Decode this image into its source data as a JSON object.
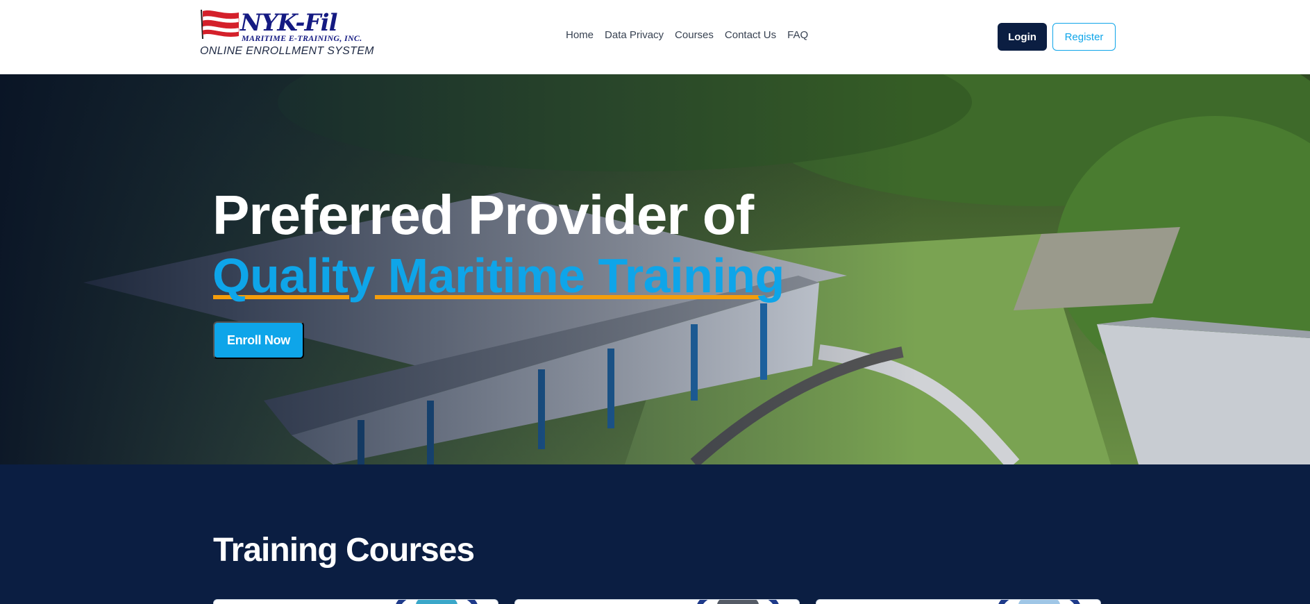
{
  "header": {
    "logo": {
      "brand": "NYK-Fil",
      "subtitle": "MARITIME E-TRAINING, INC.",
      "system_name": "ONLINE ENROLLMENT SYSTEM"
    },
    "nav": [
      {
        "label": "Home"
      },
      {
        "label": "Data Privacy"
      },
      {
        "label": "Courses"
      },
      {
        "label": "Contact Us"
      },
      {
        "label": "FAQ"
      }
    ],
    "login_label": "Login",
    "register_label": "Register"
  },
  "hero": {
    "title_line1": "Preferred Provider of",
    "title_line2": "Quality Maritime Training",
    "cta_label": "Enroll Now"
  },
  "courses": {
    "title": "Training Courses",
    "card_count_visible": 3
  },
  "colors": {
    "navy": "#0b1e42",
    "accent_blue": "#0ea5e9",
    "underline_orange": "#f59e0b",
    "logo_blue": "#141a82"
  }
}
